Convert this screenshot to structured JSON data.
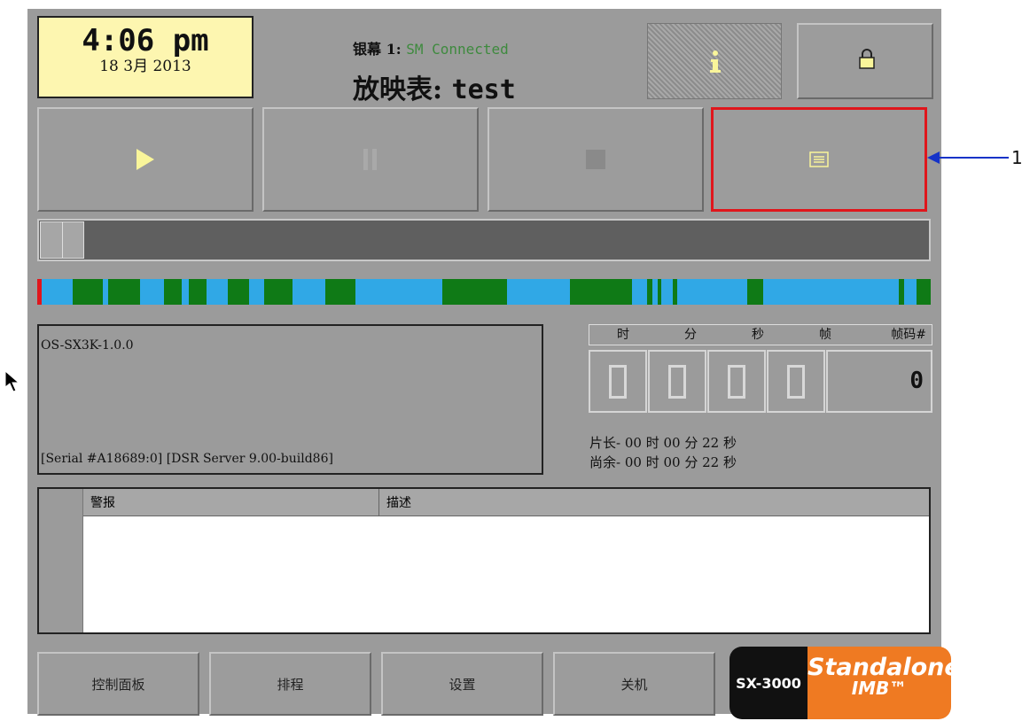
{
  "header": {
    "time": "4:06 pm",
    "date": "18  3月 2013",
    "screen_label": "银幕 1:",
    "connection_status": "SM Connected",
    "playlist_label": "放映表:",
    "playlist_name": "test"
  },
  "buttons": {
    "info_icon": "info-icon",
    "lock_icon": "lock-icon",
    "play_icon": "play-icon",
    "pause_icon": "pause-icon",
    "stop_icon": "stop-icon",
    "playlist_icon": "list-icon"
  },
  "info": {
    "version": "OS-SX3K-1.0.0",
    "serial": "[Serial #A18689:0] [DSR Server 9.00-build86]"
  },
  "timecode": {
    "headers": [
      "时",
      "分",
      "秒",
      "帧",
      "帧码#"
    ],
    "frame_number": "0",
    "duration": "片长- 00 时 00 分 22 秒",
    "remaining": "尚余- 00 时 00 分 22 秒"
  },
  "alarms": {
    "col_alarm": "警报",
    "col_description": "描述"
  },
  "nav": {
    "control_panel": "控制面板",
    "schedule": "排程",
    "settings": "设置",
    "shutdown": "关机"
  },
  "logo": {
    "model": "SX-3000",
    "standalone": "Standalone",
    "imb": "IMB™"
  },
  "annotation": {
    "number": "1"
  },
  "colors": {
    "panel": "#9b9b9b",
    "clock_bg": "#fdf6b0",
    "play_icon": "#f9f59a",
    "timeline_blue": "#30a8e6",
    "timeline_green": "#0f7a16",
    "highlight": "#e0161c",
    "annotation": "#1533c8",
    "logo_orange": "#ef7a22"
  }
}
